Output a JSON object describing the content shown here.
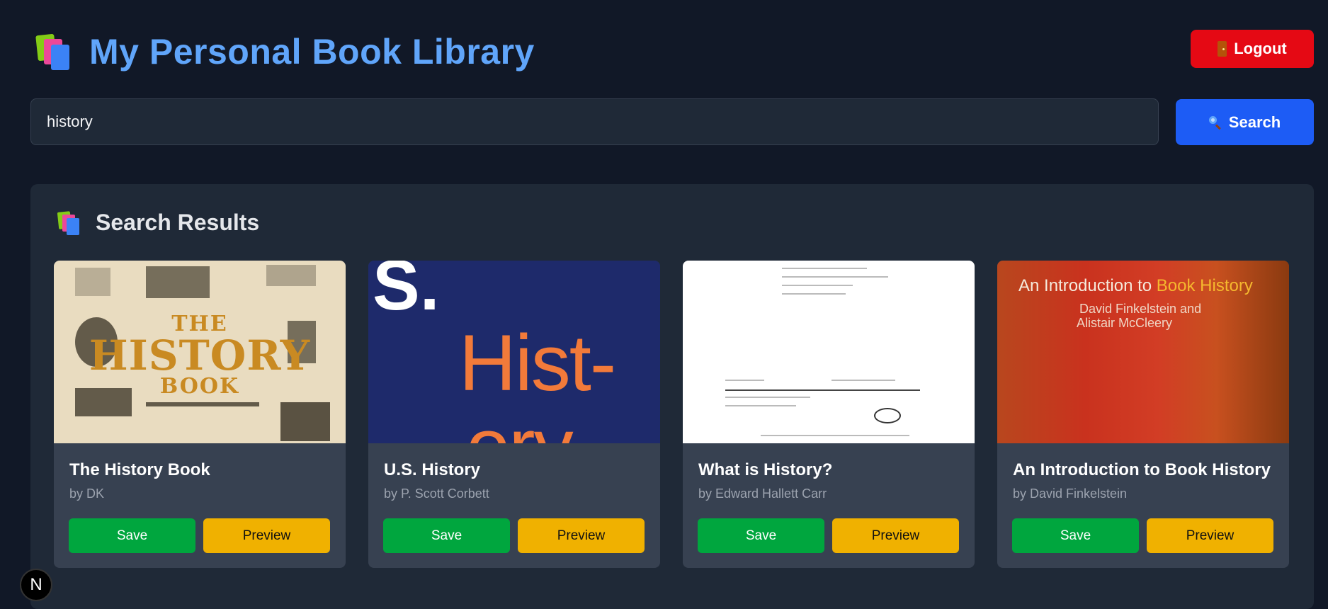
{
  "header": {
    "title": "My Personal Book Library",
    "logout_label": "Logout"
  },
  "search": {
    "value": "history",
    "button_label": "Search"
  },
  "results": {
    "title": "Search Results",
    "books": [
      {
        "title": "The History Book",
        "author": "by DK",
        "save_label": "Save",
        "preview_label": "Preview"
      },
      {
        "title": "U.S. History",
        "author": "by P. Scott Corbett",
        "save_label": "Save",
        "preview_label": "Preview"
      },
      {
        "title": "What is History?",
        "author": "by Edward Hallett Carr",
        "save_label": "Save",
        "preview_label": "Preview"
      },
      {
        "title": "An Introduction to Book History",
        "author": "by David Finkelstein",
        "save_label": "Save",
        "preview_label": "Preview"
      }
    ]
  },
  "covers": {
    "c1": {
      "line1": "THE",
      "line2": "HISTORY",
      "line3": "BOOK"
    },
    "c2": {
      "line1": "S.",
      "line2": "Hist-",
      "line3": "ory"
    },
    "c4": {
      "title_a": "An Introduction to ",
      "title_b": "Book History",
      "authors_1": "David Finkelstein and",
      "authors_2": "Alistair McCleery"
    }
  },
  "badge": {
    "label": "N"
  },
  "colors": {
    "accent": "#60a5fa",
    "logout": "#e50914",
    "search": "#1d5cf5",
    "save": "#00a63e",
    "preview": "#f0b100"
  },
  "icons": {
    "logo": "books-icon",
    "logout": "door-icon",
    "search": "magnifier-icon"
  }
}
